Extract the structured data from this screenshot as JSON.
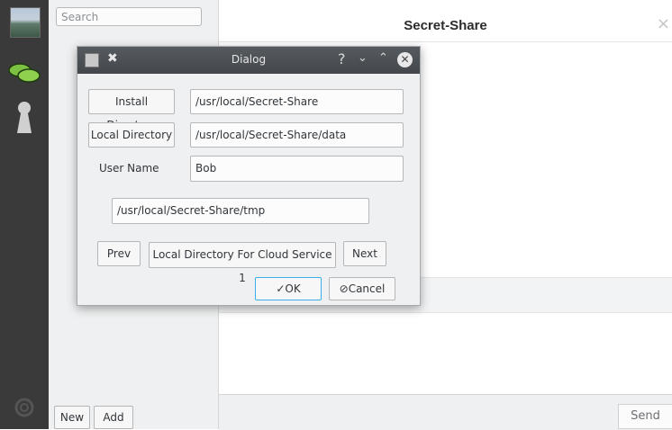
{
  "sidebar": {
    "avatar_icon": "landscape-avatar-icon",
    "chat_icon": "chat-bubbles-icon",
    "key_icon": "keyhole-icon",
    "settings_icon": "gear-icon"
  },
  "left_pane": {
    "search_placeholder": "Search",
    "new_label": "New",
    "add_label": "Add"
  },
  "main": {
    "title": "Secret-Share",
    "close_glyph": "×",
    "send_label": "Send"
  },
  "dialog": {
    "title": "Dialog",
    "help_glyph": "?",
    "min_glyph": "⌄",
    "max_glyph": "⌃",
    "close_glyph": "✕",
    "pin_glyph": "✖",
    "install_dir_button": "Install Directory",
    "install_dir_value": "/usr/local/Secret-Share",
    "local_dir_button": "Local Directory",
    "local_dir_value": "/usr/local/Secret-Share/data",
    "user_name_label": "User Name",
    "user_name_value": "Bob",
    "tmp_dir_value": "/usr/local/Secret-Share/tmp",
    "prev_label": "Prev",
    "cloud_dir_button": "Local Directory For Cloud Service 1",
    "next_label": "Next",
    "ok_label": "✓OK",
    "cancel_label": "⊘Cancel"
  },
  "colors": {
    "sidebar_bg": "#3a3a3a",
    "pane_bg": "#eff0f1",
    "titlebar_dark": "#4b4f53",
    "chat_green": "#7cc242",
    "ok_focus": "#3daee9"
  }
}
